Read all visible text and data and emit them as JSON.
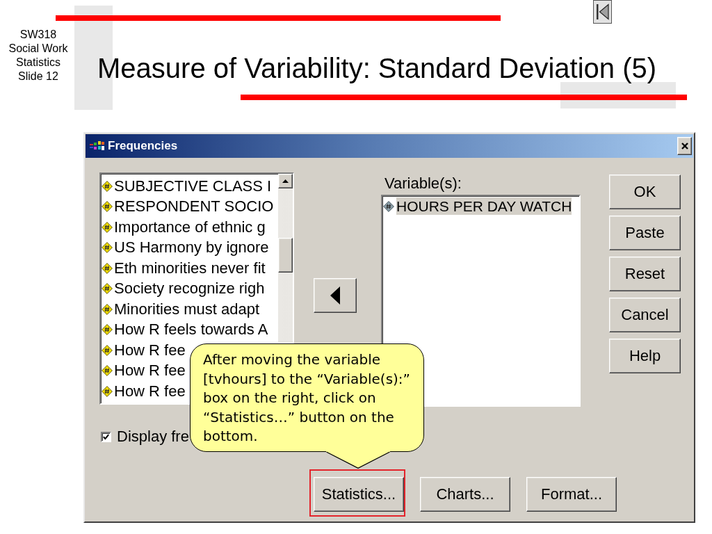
{
  "slide": {
    "course_label": [
      "SW318",
      "Social Work",
      "Statistics",
      "Slide 12"
    ],
    "title": "Measure of Variability: Standard Deviation (5)"
  },
  "dialog": {
    "title": "Frequencies",
    "source_list": {
      "items": [
        {
          "label": "SUBJECTIVE CLASS I",
          "selected": false
        },
        {
          "label": "RESPONDENT SOCIO",
          "selected": false
        },
        {
          "label": "Importance of ethnic g",
          "selected": false
        },
        {
          "label": "US Harmony by ignore",
          "selected": false
        },
        {
          "label": "Eth minorities never fit",
          "selected": false
        },
        {
          "label": "Society recognize righ",
          "selected": false
        },
        {
          "label": "Minorities must adapt",
          "selected": false
        },
        {
          "label": "How R feels towards A",
          "selected": false
        },
        {
          "label": "How R fee",
          "selected": false
        },
        {
          "label": "How R fee",
          "selected": false
        },
        {
          "label": "How R fee",
          "selected": false
        }
      ]
    },
    "target_list": {
      "label": "Variable(s):",
      "items": [
        {
          "label": "HOURS PER DAY WATCH",
          "selected": true
        }
      ]
    },
    "side_buttons": [
      "OK",
      "Paste",
      "Reset",
      "Cancel",
      "Help"
    ],
    "display_option": {
      "label": "Display fre",
      "checked": true
    },
    "bottom_buttons": [
      {
        "label": "Statistics...",
        "highlighted": true
      },
      {
        "label": "Charts...",
        "highlighted": false
      },
      {
        "label": "Format...",
        "highlighted": false
      }
    ]
  },
  "callout": {
    "text": "After moving the variable [tvhours] to the “Variable(s):” box on the right, click on “Statistics…” button on the bottom."
  }
}
